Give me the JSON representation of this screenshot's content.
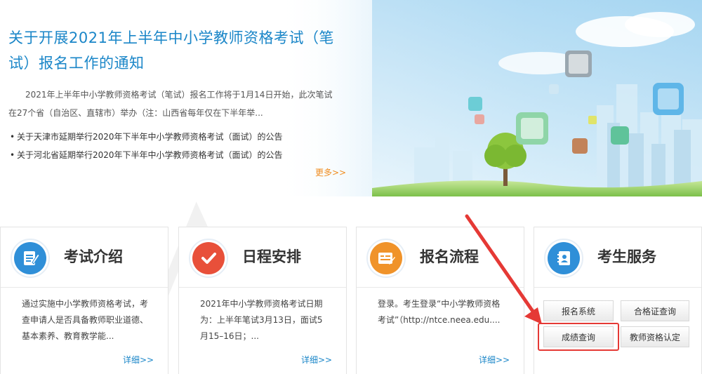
{
  "banner": {
    "title": "关于开展2021年上半年中小学教师资格考试（笔试）报名工作的通知",
    "summary": "2021年上半年中小学教师资格考试（笔试）报名工作将于1月14日开始，此次笔试在27个省（自治区、直辖市）举办（注：山西省每年仅在下半年举...",
    "news": [
      "关于天津市延期举行2020年下半年中小学教师资格考试（面试）的公告",
      "关于河北省延期举行2020年下半年中小学教师资格考试（面试）的公告"
    ],
    "bullet": "•",
    "more_label": "更多>>"
  },
  "cards": [
    {
      "title": "考试介绍",
      "icon": "document-edit-icon",
      "color": "#2f8fd8",
      "body": "通过实施中小学教师资格考试，考查申请人是否具备教师职业道德、基本素养、教育教学能...",
      "more_label": "详细>>"
    },
    {
      "title": "日程安排",
      "icon": "checkmark-icon",
      "color": "#e8503a",
      "body": "2021年中小学教师资格考试日期为：上半年笔试3月13日，面试5月15–16日；...",
      "more_label": "详细>>"
    },
    {
      "title": "报名流程",
      "icon": "form-edit-icon",
      "color": "#f0932a",
      "body": "登录。考生登录“中小学教师资格考试”（http://ntce.neea.edu....",
      "more_label": "详细>>"
    },
    {
      "title": "考生服务",
      "icon": "contact-book-icon",
      "color": "#2f8fd8",
      "buttons": [
        "报名系统",
        "合格证查询",
        "成绩查询",
        "教师资格认定"
      ]
    }
  ],
  "accent_colors": {
    "title_blue": "#1a86c8",
    "more_orange": "#f08c1e",
    "annotation_red": "#e53935"
  }
}
